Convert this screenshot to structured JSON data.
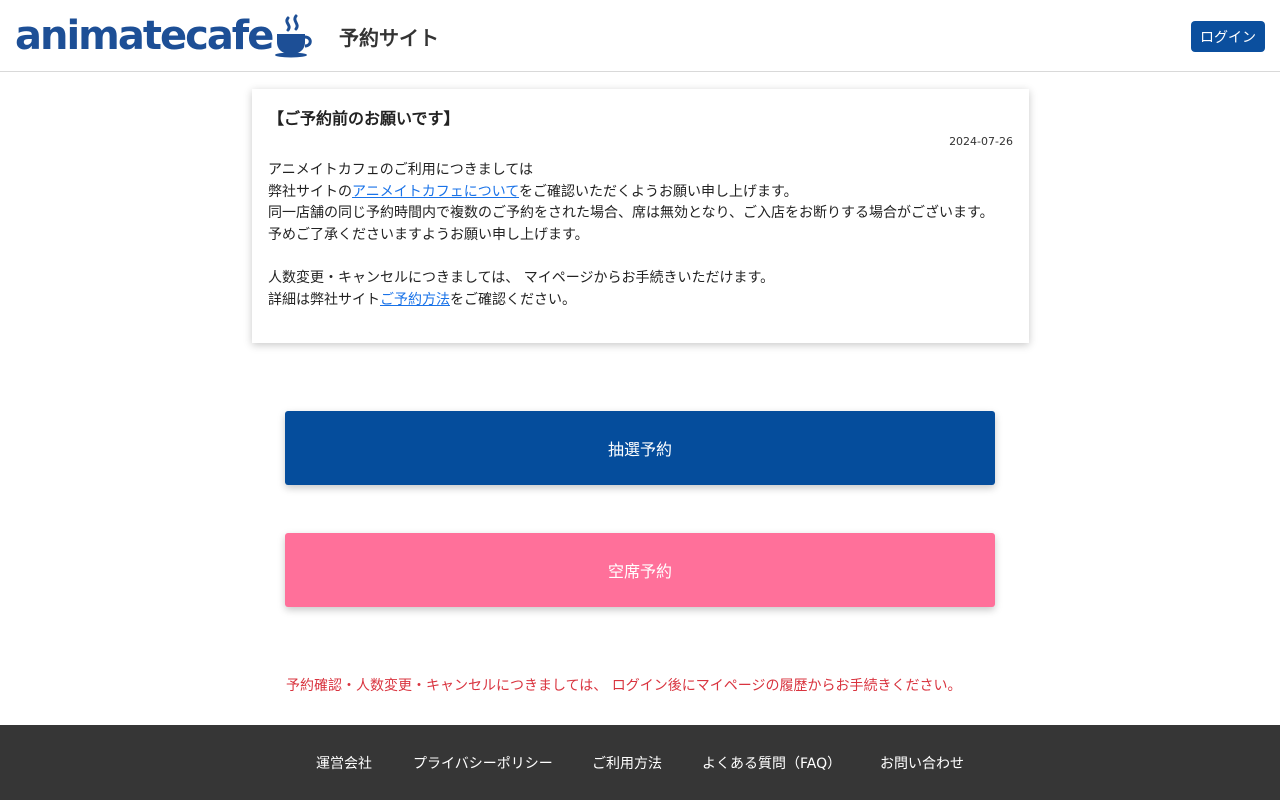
{
  "header": {
    "logo_text": "animatecafe",
    "site_title": "予約サイト",
    "login_label": "ログイン"
  },
  "notice": {
    "title": "【ご予約前のお願いです】",
    "date": "2024-07-26",
    "line1": "アニメイトカフェのご利用につきましては",
    "line2_prefix": "弊社サイトの",
    "line2_link": "アニメイトカフェについて",
    "line2_suffix": "をご確認いただくようお願い申し上げます。",
    "line3": "同一店舗の同じ予約時間内で複数のご予約をされた場合、席は無効となり、ご入店をお断りする場合がございます。",
    "line4": "予めご了承くださいますようお願い申し上げます。",
    "line5": "人数変更・キャンセルにつきましては、 マイページからお手続きいただけます。",
    "line6_prefix": "詳細は弊社サイト",
    "line6_link": "ご予約方法",
    "line6_suffix": "をご確認ください。"
  },
  "actions": {
    "lottery_label": "抽選予約",
    "vacant_label": "空席予約"
  },
  "warning": "予約確認・人数変更・キャンセルにつきましては、 ログイン後にマイページの履歴からお手続きください。",
  "footer": {
    "links": [
      "運営会社",
      "プライバシーポリシー",
      "ご利用方法",
      "よくある質問（FAQ）",
      "お問い合わせ"
    ]
  },
  "colors": {
    "brand_blue": "#0b4f9e",
    "accent_pink": "#ff709a",
    "warning_red": "#d9343f",
    "footer_bg": "#363636"
  }
}
